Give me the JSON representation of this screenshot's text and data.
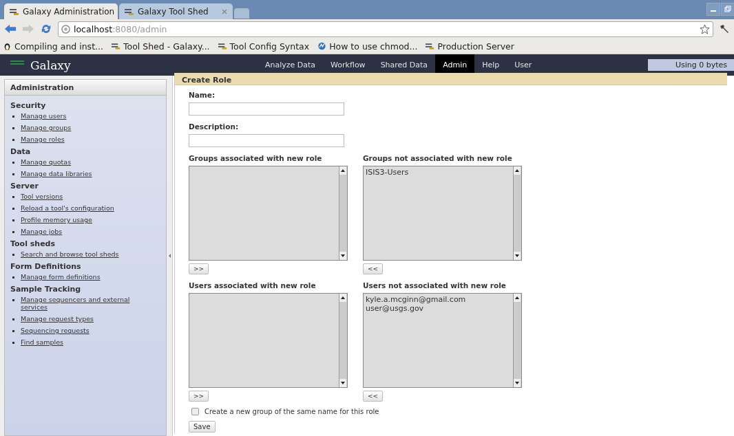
{
  "browser": {
    "tabs": [
      {
        "title": "Galaxy Administration",
        "selected": true
      },
      {
        "title": "Galaxy Tool Shed",
        "selected": false
      }
    ],
    "address": {
      "host": "localhost",
      "path": ":8080/admin"
    },
    "bookmarks": [
      {
        "label": "Compiling and inst...",
        "kind": "penguin"
      },
      {
        "label": "Tool Shed - Galaxy...",
        "kind": "galaxy"
      },
      {
        "label": "Tool Config Syntax",
        "kind": "galaxy"
      },
      {
        "label": "How to use chmod...",
        "kind": "globe"
      },
      {
        "label": "Production Server",
        "kind": "galaxy"
      }
    ]
  },
  "masthead": {
    "brand": "Galaxy",
    "nav": [
      {
        "label": "Analyze Data",
        "selected": false
      },
      {
        "label": "Workflow",
        "selected": false
      },
      {
        "label": "Shared Data",
        "selected": false
      },
      {
        "label": "Admin",
        "selected": true
      },
      {
        "label": "Help",
        "selected": false
      },
      {
        "label": "User",
        "selected": false
      }
    ],
    "usage": "Using 0 bytes"
  },
  "sidebar": {
    "title": "Administration",
    "sections": [
      {
        "heading": "Security",
        "items": [
          "Manage users",
          "Manage groups",
          "Manage roles"
        ]
      },
      {
        "heading": "Data",
        "items": [
          "Manage quotas",
          "Manage data libraries"
        ]
      },
      {
        "heading": "Server",
        "items": [
          "Tool versions",
          "Reload a tool's configuration",
          "Profile memory usage",
          "Manage jobs"
        ]
      },
      {
        "heading": "Tool sheds",
        "items": [
          "Search and browse tool sheds"
        ]
      },
      {
        "heading": "Form Definitions",
        "items": [
          "Manage form definitions"
        ]
      },
      {
        "heading": "Sample Tracking",
        "items": [
          "Manage sequencers and external services",
          "Manage request types",
          "Sequencing requests",
          "Find samples"
        ]
      }
    ]
  },
  "form": {
    "title": "Create Role",
    "fields": [
      {
        "label": "Name:"
      },
      {
        "label": "Description:"
      }
    ],
    "pairs": [
      {
        "left": {
          "label": "Groups associated with new role",
          "button": ">>"
        },
        "right": {
          "label": "Groups not associated with new role",
          "options": [
            "ISIS3-Users"
          ],
          "button": "<<"
        }
      },
      {
        "left": {
          "label": "Users associated with new role",
          "button": ">>"
        },
        "right": {
          "label": "Users not associated with new role",
          "options": [
            "kyle.a.mcginn@gmail.com",
            "user@usgs.gov"
          ],
          "button": "<<"
        }
      }
    ],
    "checkbox": {
      "label": "Create a new group of the same name for this role",
      "checked": false
    },
    "submit": "Save"
  }
}
